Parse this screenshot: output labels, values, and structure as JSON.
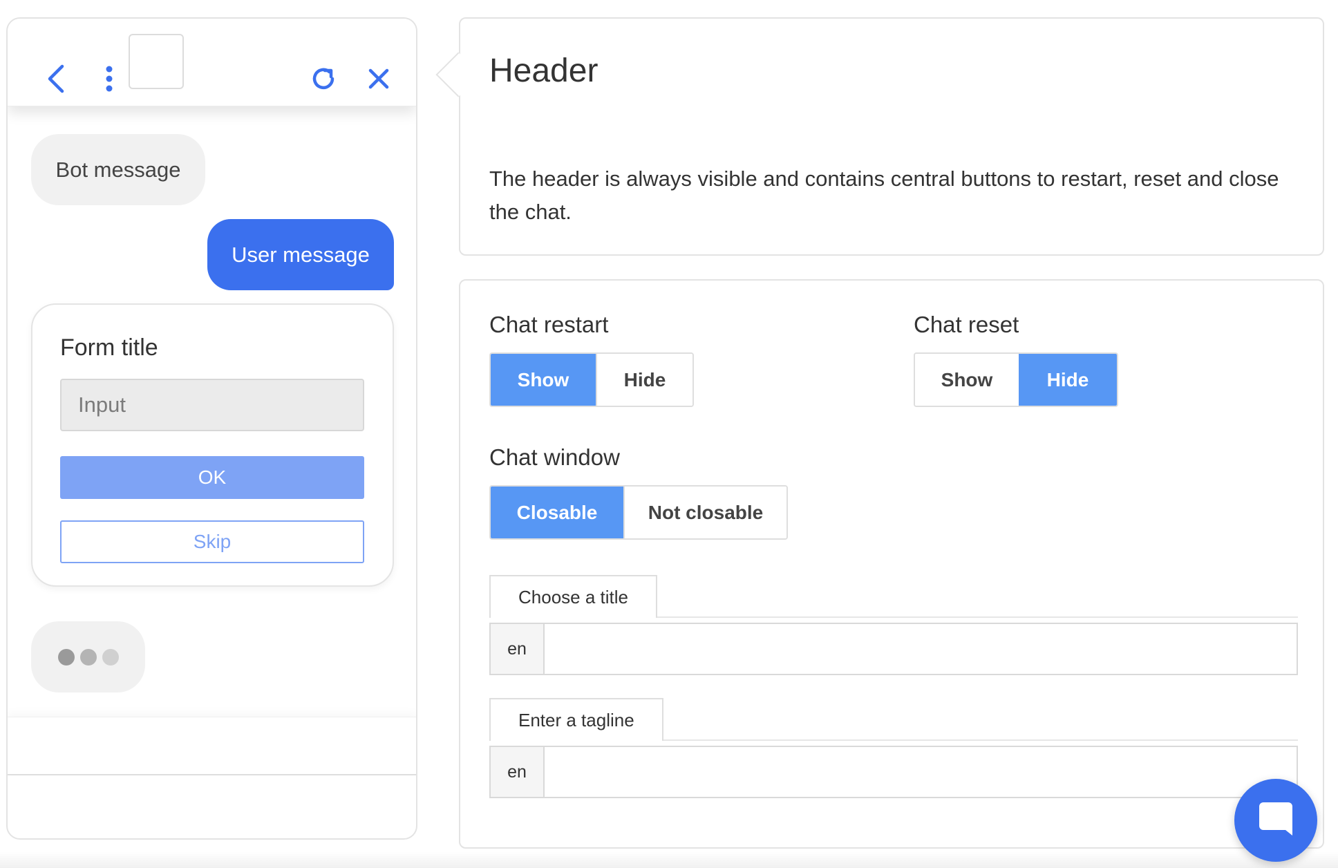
{
  "colors": {
    "primary": "#3b70ee",
    "toggle_active": "#5797f4",
    "ok_button": "#7ea3f5",
    "bubble_bg": "#f1f1f1"
  },
  "chat_preview": {
    "header": {
      "icons": [
        "chevron-left-icon",
        "more-vertical-icon",
        "refresh-icon",
        "close-icon"
      ]
    },
    "bot_message": "Bot message",
    "user_message": "User message",
    "form": {
      "title": "Form title",
      "input_placeholder": "Input",
      "ok_label": "OK",
      "skip_label": "Skip"
    }
  },
  "info": {
    "title": "Header",
    "description": "The header is always visible and contains central buttons to restart, reset and close the chat."
  },
  "settings": {
    "chat_restart": {
      "label": "Chat restart",
      "options": [
        "Show",
        "Hide"
      ],
      "selected": "Show"
    },
    "chat_reset": {
      "label": "Chat reset",
      "options": [
        "Show",
        "Hide"
      ],
      "selected": "Hide"
    },
    "chat_window": {
      "label": "Chat window",
      "options": [
        "Closable",
        "Not closable"
      ],
      "selected": "Closable"
    },
    "title_field": {
      "tab_label": "Choose a title",
      "lang": "en",
      "value": ""
    },
    "tagline_field": {
      "tab_label": "Enter a tagline",
      "lang": "en",
      "value": ""
    }
  },
  "launcher": {
    "icon": "chat-bubble-icon"
  }
}
